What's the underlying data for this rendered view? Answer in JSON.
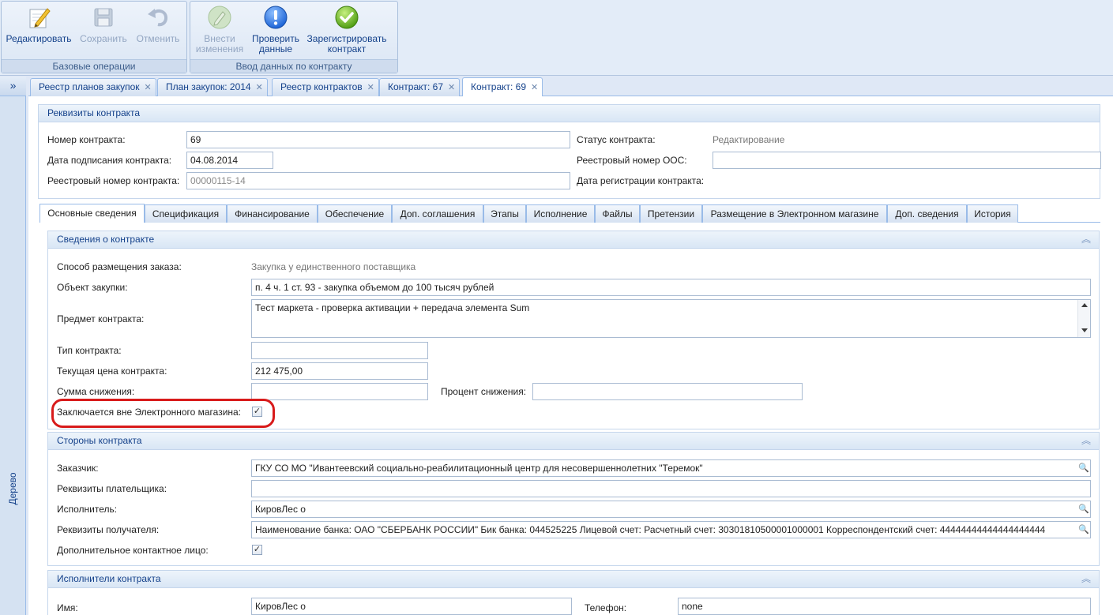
{
  "ribbon": {
    "groups": [
      {
        "label": "Базовые операции",
        "buttons": [
          {
            "label": "Редактировать",
            "icon": "edit-icon",
            "enabled": true
          },
          {
            "label": "Сохранить",
            "icon": "save-icon",
            "enabled": false
          },
          {
            "label": "Отменить",
            "icon": "undo-icon",
            "enabled": false
          }
        ]
      },
      {
        "label": "Ввод данных по контракту",
        "buttons": [
          {
            "label": "Внести изменения",
            "icon": "change-icon",
            "enabled": false
          },
          {
            "label": "Проверить данные",
            "icon": "info-icon",
            "enabled": true
          },
          {
            "label": "Зарегистрировать контракт",
            "icon": "checkmark-icon",
            "enabled": true
          }
        ]
      }
    ]
  },
  "leftbar": {
    "expand_glyph": "»",
    "label": "Дерево"
  },
  "doc_tabs": [
    {
      "label": "Реестр планов закупок"
    },
    {
      "label": "План закупок: 2014"
    },
    {
      "label": "Реестр контрактов"
    },
    {
      "label": "Контракт: 67"
    },
    {
      "label": "Контракт: 69",
      "active": true
    }
  ],
  "requisites": {
    "title": "Реквизиты контракта",
    "number_label": "Номер контракта:",
    "number_value": "69",
    "sign_date_label": "Дата подписания контракта:",
    "sign_date_value": "04.08.2014",
    "reg_number_label": "Реестровый номер контракта:",
    "reg_number_value": "00000115-14",
    "status_label": "Статус контракта:",
    "status_value": "Редактирование",
    "oos_label": "Реестровый номер ООС:",
    "oos_value": "",
    "reg_date_label": "Дата регистрации контракта:"
  },
  "inner_tabs": [
    {
      "label": "Основные сведения",
      "active": true
    },
    {
      "label": "Спецификация"
    },
    {
      "label": "Финансирование"
    },
    {
      "label": "Обеспечение"
    },
    {
      "label": "Доп. соглашения"
    },
    {
      "label": "Этапы"
    },
    {
      "label": "Исполнение"
    },
    {
      "label": "Файлы"
    },
    {
      "label": "Претензии"
    },
    {
      "label": "Размещение в Электронном магазине"
    },
    {
      "label": "Доп. сведения"
    },
    {
      "label": "История"
    }
  ],
  "contract_info": {
    "title": "Сведения о контракте",
    "method_label": "Способ размещения заказа:",
    "method_value": "Закупка у единственного поставщика",
    "object_label": "Объект закупки:",
    "object_value": "п. 4 ч. 1 ст. 93 - закупка объемом до 100 тысяч рублей",
    "subject_label": "Предмет контракта:",
    "subject_value": "Тест маркета - проверка активации + передача элемента Sum",
    "type_label": "Тип контракта:",
    "type_value": "",
    "price_label": "Текущая цена контракта:",
    "price_value": "212 475,00",
    "reduction_label": "Сумма снижения:",
    "reduction_value": "",
    "percent_label": "Процент снижения:",
    "percent_value": "",
    "outside_label": "Заключается вне Электронного магазина:",
    "outside_checked": "✓"
  },
  "parties": {
    "title": "Стороны контракта",
    "customer_label": "Заказчик:",
    "customer_value": "ГКУ СО МО \"Ивантеевский социально-реабилитационный центр для несовершеннолетних \"Теремок\"",
    "payer_label": "Реквизиты плательщика:",
    "payer_value": "",
    "executor_label": "Исполнитель:",
    "executor_value": "КировЛес о",
    "recipient_label": "Реквизиты получателя:",
    "recipient_value": "Наименование банка: ОАО \"СБЕРБАНК РОССИИ\" Бик банка: 044525225 Лицевой счет:  Расчетный счет: 30301810500001000001 Корреспондентский счет: 44444444444444444444",
    "contact_label": "Дополнительное контактное лицо:",
    "contact_checked": "✓"
  },
  "executors": {
    "title": "Исполнители контракта",
    "name_label": "Имя:",
    "name_value": "КировЛес о",
    "phone_label": "Телефон:",
    "phone_value": "none"
  },
  "glyphs": {
    "collapse": "︽",
    "close": "✕",
    "search": "🔍"
  },
  "colors": {
    "ribbon_text": "#15428b",
    "border": "#99bbe8",
    "highlight": "#d81b1b"
  }
}
